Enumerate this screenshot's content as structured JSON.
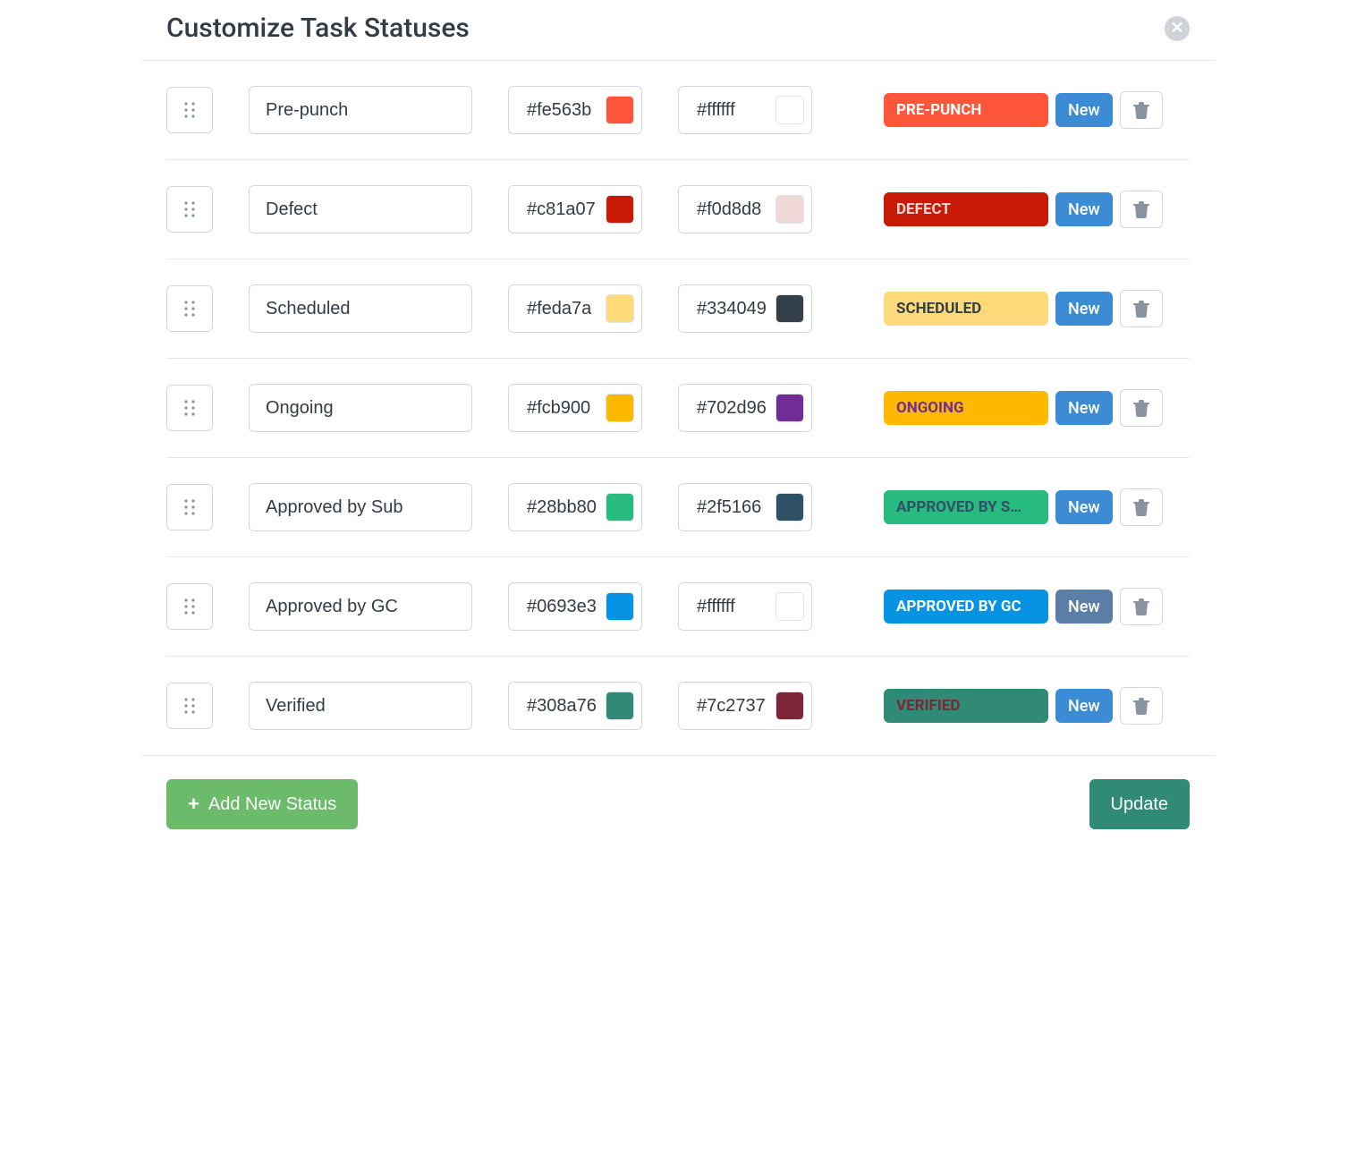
{
  "header": {
    "title": "Customize Task Statuses"
  },
  "new_label": "New",
  "statuses": [
    {
      "name": "Pre-punch",
      "bg": "#fe563b",
      "fg": "#ffffff",
      "badge": "PRE-PUNCH",
      "new_muted": false
    },
    {
      "name": "Defect",
      "bg": "#c81a07",
      "fg": "#f0d8d8",
      "badge": "DEFECT",
      "new_muted": false
    },
    {
      "name": "Scheduled",
      "bg": "#feda7a",
      "fg": "#334049",
      "badge": "SCHEDULED",
      "new_muted": false
    },
    {
      "name": "Ongoing",
      "bg": "#fcb900",
      "fg": "#702d96",
      "badge": "ONGOING",
      "new_muted": false
    },
    {
      "name": "Approved by Sub",
      "bg": "#28bb80",
      "fg": "#2f5166",
      "badge": "APPROVED BY S…",
      "new_muted": false
    },
    {
      "name": "Approved by GC",
      "bg": "#0693e3",
      "fg": "#ffffff",
      "badge": "APPROVED BY GC",
      "new_muted": true
    },
    {
      "name": "Verified",
      "bg": "#308a76",
      "fg": "#7c2737",
      "badge": "VERIFIED",
      "new_muted": false
    }
  ],
  "footer": {
    "add_label": "Add New Status",
    "update_label": "Update"
  }
}
